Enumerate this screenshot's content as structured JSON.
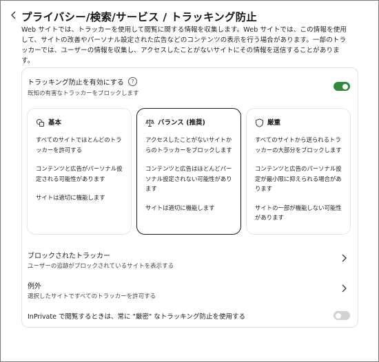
{
  "header": {
    "back_icon": "chevron-left-icon",
    "title": "プライバシー/検索/サービス / トラッキング防止",
    "description_lines": [
      "Web サイトでは、トラッカーを使用して閲覧に関する情報を収集します。Web サイトでは、この情報を使用",
      "して、サイトの改善やパーソナル設定された広告などのコンテンツの表示を行う場合があります。一部のトラ",
      "ッカーでは、ユーザーの情報を収集し、アクセスしたことがないサイトにその情報を送信することがありま",
      "す。"
    ]
  },
  "tracking": {
    "enable_title": "トラッキング防止を有効にする",
    "help_icon": "question-circle-icon",
    "help_glyph": "?",
    "enable_subtitle": "既知の有害なトラッカーをブロックします",
    "enabled": true,
    "accent_color": "#2e8b3a"
  },
  "levels": [
    {
      "title": "基本",
      "icon": "shapes-icon",
      "selected": false,
      "lines": [
        "すべてのサイトでほとんどのトラッカーを許可する",
        "コンテンツと広告がパーソナル設定される可能性があります",
        "サイトは適切に機能します"
      ]
    },
    {
      "title": "バランス (推奨)",
      "icon": "scale-icon",
      "selected": true,
      "lines": [
        "アクセスしたことがないサイトからのトラッカーをブロックします",
        "コンテンツと広告はほとんどパーソナル設定されない可能性があります",
        "サイトは適切に機能します"
      ]
    },
    {
      "title": "厳重",
      "icon": "shield-icon",
      "selected": false,
      "lines": [
        "すべてのサイトから送られるトラッカーの大部分をブロックします",
        "コンテンツと広告のパーソナル設定が最小限に抑えられる場合があります",
        "サイトの一部が機能しない可能性があります"
      ]
    }
  ],
  "blocked": {
    "title": "ブロックされたトラッカー",
    "subtitle": "ユーザーの追跡がブロックされているサイトを表示する",
    "chevron_icon": "chevron-right-icon"
  },
  "exceptions": {
    "title": "例外",
    "subtitle": "選択したサイトですべてのトラッカーを許可する",
    "chevron_icon": "chevron-right-icon"
  },
  "inprivate": {
    "label": "InPrivate で閲覧するときは、常に \"厳密\" なトラッキング防止を使用する",
    "enabled": false
  }
}
